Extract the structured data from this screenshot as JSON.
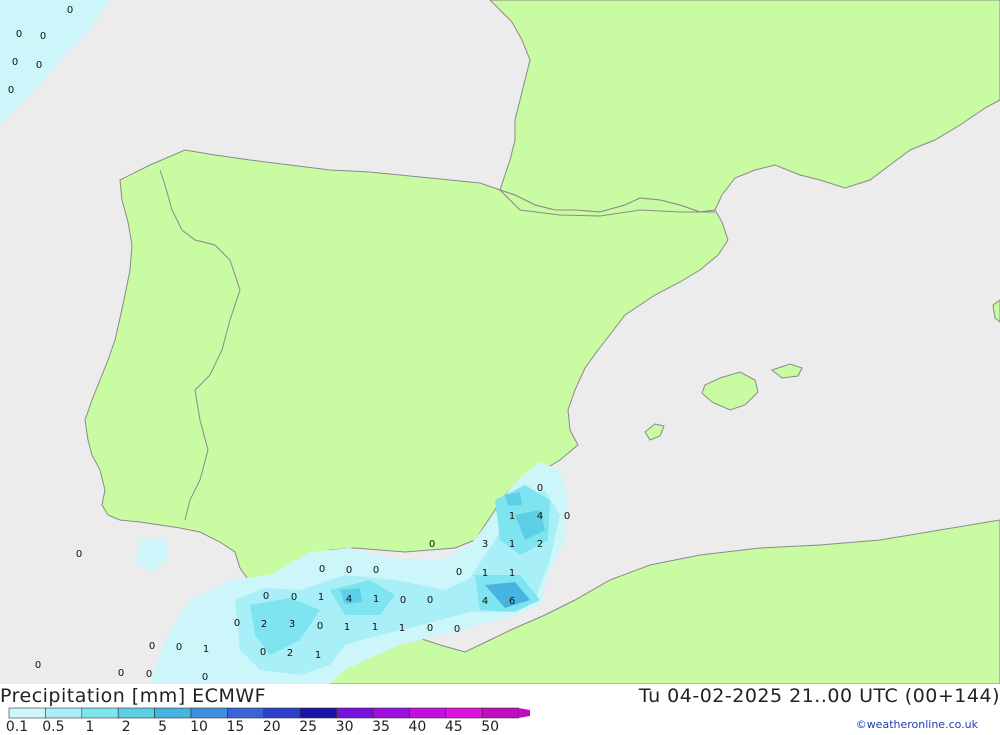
{
  "header": {
    "title": "Precipitation [mm] ECMWF",
    "valid_time": "Tu 04-02-2025 21..00 UTC (00+144)",
    "credit": "©weatheronline.co.uk"
  },
  "colors": {
    "sea": "#ececec",
    "land": "#c9fba2",
    "coast": "#8a8a8a"
  },
  "legend": {
    "labels": [
      "0.1",
      "0.5",
      "1",
      "2",
      "5",
      "10",
      "15",
      "20",
      "25",
      "30",
      "35",
      "40",
      "45",
      "50"
    ],
    "colors": [
      "#cdf6fb",
      "#a8eff7",
      "#7ee5f0",
      "#5ccfe6",
      "#47b3e0",
      "#3f8fdc",
      "#3b63d8",
      "#2e3fcb",
      "#1c14a8",
      "#7a10e0",
      "#9b10e0",
      "#c210e0",
      "#e010e0",
      "#c20cc2"
    ]
  },
  "precip_values": [
    "0",
    "0",
    "0",
    "0",
    "0",
    "0",
    "0",
    "0",
    "0",
    "0",
    "0",
    "0",
    "1",
    "4",
    "0",
    "3",
    "1",
    "2",
    "0",
    "0",
    "0",
    "0",
    "1",
    "1",
    "0",
    "1",
    "4",
    "1",
    "0",
    "0",
    "4",
    "6",
    "0",
    "2",
    "3",
    "0",
    "1",
    "1",
    "1",
    "0",
    "0",
    "0",
    "1",
    "0",
    "2",
    "1",
    "0",
    "0",
    "0"
  ]
}
